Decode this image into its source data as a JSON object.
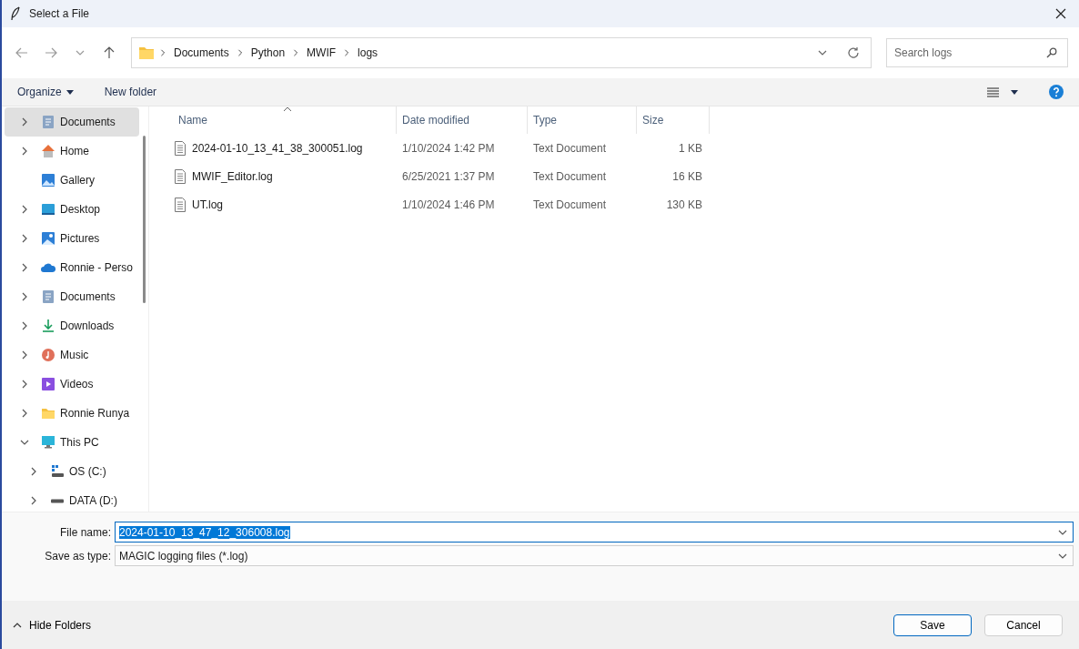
{
  "window": {
    "title": "Select a File"
  },
  "address_bar": {
    "path": [
      "Documents",
      "Python",
      "MWIF",
      "logs"
    ]
  },
  "search": {
    "placeholder": "Search logs"
  },
  "toolbar": {
    "organize": "Organize",
    "new_folder": "New folder"
  },
  "sidebar": {
    "items": [
      {
        "label": "Documents",
        "kind": "documents",
        "expanded": false,
        "selected": true
      },
      {
        "label": "Home",
        "kind": "home",
        "expanded": false,
        "selected": false
      },
      {
        "label": "Gallery",
        "kind": "gallery",
        "selected": false
      },
      {
        "label": "Desktop",
        "kind": "desktop",
        "expanded": false,
        "selected": false
      },
      {
        "label": "Pictures",
        "kind": "pictures",
        "expanded": false,
        "selected": false
      },
      {
        "label": "Ronnie - Perso",
        "kind": "cloud",
        "expanded": false,
        "selected": false
      },
      {
        "label": "Documents",
        "kind": "documents",
        "expanded": false,
        "selected": false
      },
      {
        "label": "Downloads",
        "kind": "downloads",
        "expanded": false,
        "selected": false
      },
      {
        "label": "Music",
        "kind": "music",
        "expanded": false,
        "selected": false
      },
      {
        "label": "Videos",
        "kind": "videos",
        "expanded": false,
        "selected": false
      },
      {
        "label": "Ronnie Runya",
        "kind": "folder",
        "expanded": false,
        "selected": false
      },
      {
        "label": "This PC",
        "kind": "pc",
        "expanded": true,
        "selected": false,
        "children": [
          {
            "label": "OS (C:)",
            "kind": "system-drive",
            "expanded": false,
            "selected": false
          },
          {
            "label": "DATA (D:)",
            "kind": "drive",
            "expanded": false,
            "selected": false
          }
        ]
      }
    ]
  },
  "table": {
    "columns": [
      {
        "label": "Name",
        "sorted": true
      },
      {
        "label": "Date modified",
        "sorted": false
      },
      {
        "label": "Type",
        "sorted": false
      },
      {
        "label": "Size",
        "sorted": false
      }
    ],
    "rows": [
      {
        "name": "2024-01-10_13_41_38_300051.log",
        "date": "1/10/2024 1:42 PM",
        "type": "Text Document",
        "size": "1 KB",
        "selected": false
      },
      {
        "name": "MWIF_Editor.log",
        "date": "6/25/2021 1:37 PM",
        "type": "Text Document",
        "size": "16 KB",
        "selected": false
      },
      {
        "name": "UT.log",
        "date": "1/10/2024 1:46 PM",
        "type": "Text Document",
        "size": "130 KB",
        "selected": false
      }
    ]
  },
  "file_name": {
    "label": "File name:",
    "value": "2024-01-10_13_47_12_306008.log",
    "selected": true
  },
  "save_as_type": {
    "label": "Save as type:",
    "value": "MAGIC logging files (*.log)"
  },
  "footer": {
    "hide_folders": "Hide Folders",
    "save": "Save",
    "cancel": "Cancel"
  }
}
